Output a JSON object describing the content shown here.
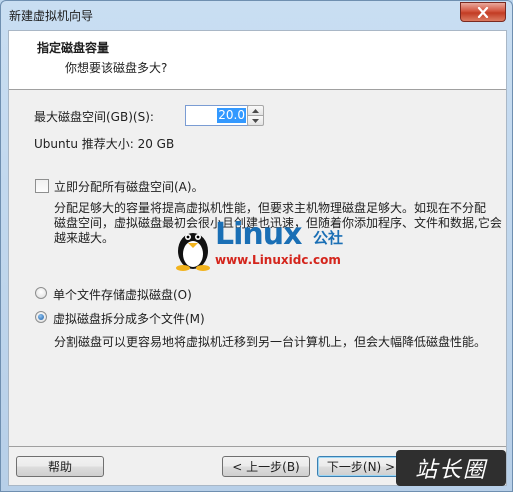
{
  "window": {
    "title": "新建虚拟机向导"
  },
  "header": {
    "title": "指定磁盘容量",
    "subtitle": "你想要该磁盘多大?"
  },
  "disk": {
    "max_size_label": "最大磁盘空间(GB)(S):",
    "max_size_value": "20.0",
    "recommended": "Ubuntu 推荐大小: 20 GB"
  },
  "allocate": {
    "label": "立即分配所有磁盘空间(A)。",
    "checked": false,
    "description_lines": [
      "分配足够大的容量将提高虚拟机性能，但要求主机物理磁盘足够大。如现在不分配",
      "磁盘空间，虚拟磁盘最初会很小且创建也迅速，但随着你添加程序、文件和数据,它会",
      "越来越大。"
    ]
  },
  "storage": {
    "single_label": "单个文件存储虚拟磁盘(O)",
    "split_label": "虚拟磁盘拆分成多个文件(M)",
    "selected": "split",
    "split_description": "分割磁盘可以更容易地将虚拟机迁移到另一台计算机上，但会大幅降低磁盘性能。"
  },
  "watermark": {
    "brand": "Linux",
    "brand_suffix": "公社",
    "url": "www.Linuxidc.com"
  },
  "buttons": {
    "help": "帮助",
    "back": "< 上一步(B)",
    "next": "下一步(N) >"
  },
  "corner_watermark": "站长圈",
  "colors": {
    "brand_blue": "#1a6fb5",
    "url_red": "#d4251c",
    "selection": "#3399ff"
  }
}
